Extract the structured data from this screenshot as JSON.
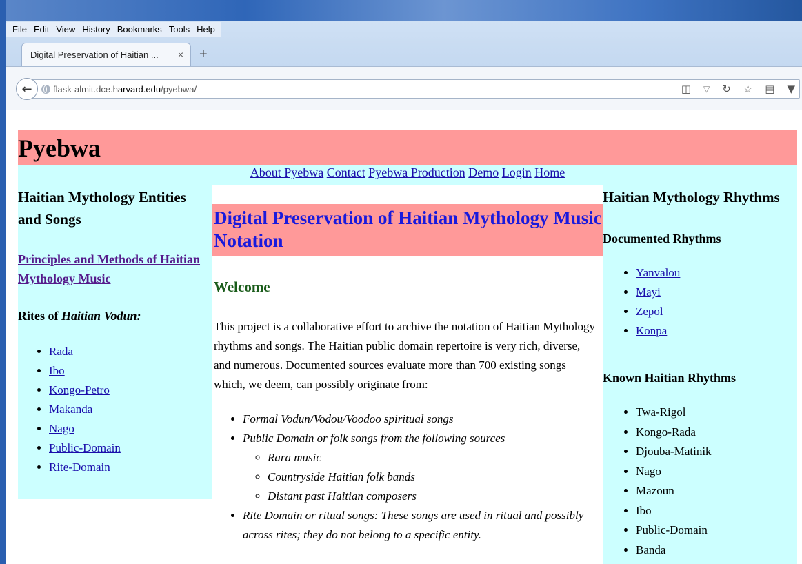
{
  "browser": {
    "menu": [
      "File",
      "Edit",
      "View",
      "History",
      "Bookmarks",
      "Tools",
      "Help"
    ],
    "tab_title": "Digital Preservation of Haitian ...",
    "tab_close": "×",
    "new_tab": "+",
    "back": "←",
    "url_prefix": "flask-almit.dce.",
    "url_host": "harvard.edu",
    "url_path": "/pyebwa/",
    "url_icons": [
      "reader-icon",
      "dropdown-icon",
      "reload-icon"
    ],
    "toolbar_icons": [
      "star-icon",
      "reading-list-icon",
      "pocket-icon"
    ]
  },
  "page": {
    "site_title": "Pyebwa",
    "nav": [
      "About Pyebwa",
      "Contact",
      "Pyebwa Production",
      "Demo",
      "Login",
      "Home"
    ],
    "left": {
      "heading": "Haitian Mythology Entities and Songs",
      "principles_link": "Principles and Methods of Haitian Mythology Music",
      "rites_label": "Rites of ",
      "rites_label_em": "Haitian Vodun:",
      "rites": [
        "Rada",
        "Ibo",
        "Kongo-Petro",
        "Makanda",
        "Nago",
        "Public-Domain",
        "Rite-Domain"
      ]
    },
    "main": {
      "title": "Digital Preservation of Haitian Mythology Music Notation",
      "welcome": "Welcome",
      "intro": "This project is a collaborative effort to archive the notation of Haitian Mythology rhythms and songs. The Haitian public domain repertoire is very rich, diverse, and numerous. Documented sources evaluate more than 700 existing songs which, we deem, can possibly originate from:",
      "sources": [
        "Formal Vodun/Vodou/Voodoo spiritual songs",
        "Public Domain or folk songs from the following sources",
        "Rite Domain or ritual songs: These songs are used in ritual and possibly across rites; they do not belong to a specific entity."
      ],
      "sub_sources": [
        "Rara music",
        "Countryside Haitian folk bands",
        "Distant past Haitian composers"
      ]
    },
    "right": {
      "heading": "Haitian Mythology Rhythms",
      "documented_label": "Documented Rhythms",
      "documented": [
        "Yanvalou",
        "Mayi",
        "Zepol",
        "Konpa"
      ],
      "known_label": "Known Haitian Rhythms",
      "known": [
        "Twa-Rigol",
        "Kongo-Rada",
        "Djouba-Matinik",
        "Nago",
        "Mazoun",
        "Ibo",
        "Public-Domain",
        "Banda"
      ]
    }
  },
  "colors": {
    "banner": "#ff9999",
    "sidebar": "#ccffff",
    "title_text": "#1a1adc",
    "welcome_text": "#1a5c1a",
    "link": "#1a0dab"
  }
}
